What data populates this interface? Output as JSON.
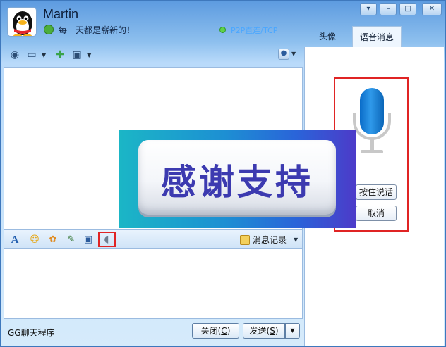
{
  "header": {
    "name": "Martin",
    "signature": "每一天都是崭新的！",
    "status": "P2P直连/TCP"
  },
  "window_buttons": [
    "▾",
    "–",
    "□",
    "✕"
  ],
  "toolbar": {
    "icons": [
      "camera-icon",
      "folder-icon",
      "app-icon",
      "screen-share-icon",
      "voice-icon"
    ]
  },
  "format_bar": {
    "icons": [
      "font-icon",
      "emoji-icon",
      "magic-emoji-icon",
      "screenshot-icon",
      "screen-icon",
      "voice-message-icon"
    ],
    "history_label": "消息记录"
  },
  "footer": {
    "app_name": "GG聊天程序",
    "close_label": "关闭(",
    "close_key": "C",
    "send_label": "发送(",
    "send_key": "S",
    "paren": ")"
  },
  "right_panel": {
    "tabs": [
      "头像",
      "语音消息"
    ],
    "active_tab": 1,
    "press_to_talk": "按住说话",
    "cancel": "取消"
  },
  "overlay": {
    "text": "感谢支持"
  },
  "colors": {
    "highlight": "#e02424",
    "mic": "#1a7fd8",
    "overlay_text": "#3c3ab0"
  }
}
